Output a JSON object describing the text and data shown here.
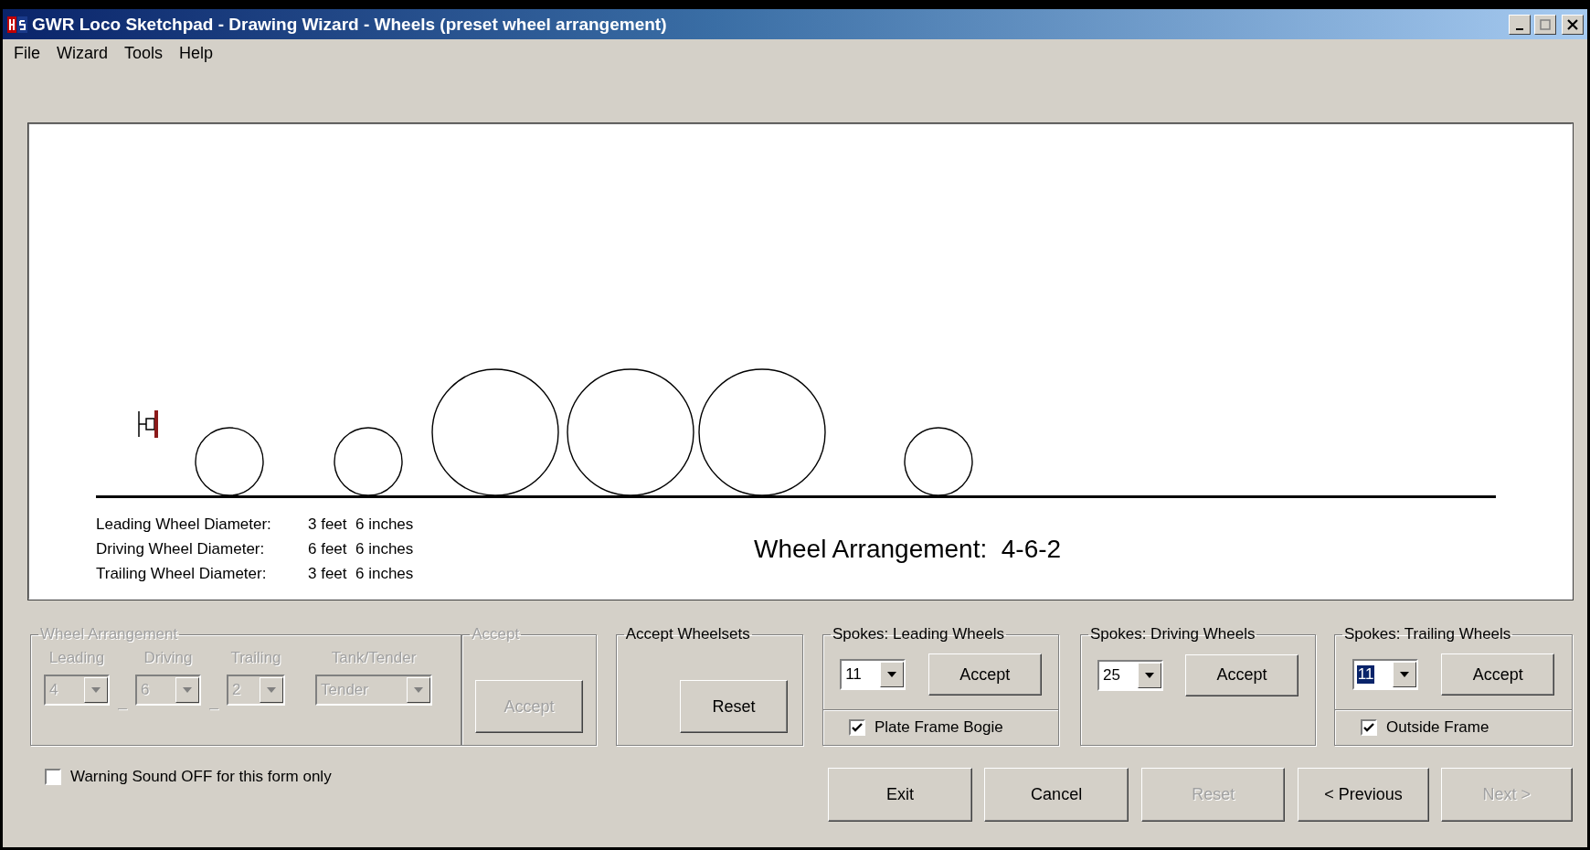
{
  "window": {
    "title": "GWR Loco Sketchpad - Drawing Wizard - Wheels (preset wheel arrangement)"
  },
  "menu": [
    {
      "label": "File"
    },
    {
      "label": "Wizard"
    },
    {
      "label": "Tools"
    },
    {
      "label": "Help"
    }
  ],
  "canvas": {
    "wheels": [
      {
        "kind": "leading"
      },
      {
        "kind": "leading"
      },
      {
        "kind": "driving"
      },
      {
        "kind": "driving"
      },
      {
        "kind": "driving"
      },
      {
        "kind": "trailing"
      }
    ],
    "diameters": [
      {
        "label": "Leading Wheel Diameter:",
        "value": "3 feet  6 inches"
      },
      {
        "label": "Driving Wheel Diameter:",
        "value": "6 feet  6 inches"
      },
      {
        "label": "Trailing Wheel Diameter:",
        "value": "3 feet  6 inches"
      }
    ],
    "arrangement": {
      "label": "Wheel Arrangement:",
      "value": "4-6-2"
    }
  },
  "wheel_arrangement": {
    "title": "Wheel Arrangement",
    "disabled": true,
    "fields": [
      {
        "label": "Leading",
        "value": "4",
        "separator": "_"
      },
      {
        "label": "Driving",
        "value": "6",
        "separator": "_"
      },
      {
        "label": "Trailing",
        "value": "2"
      },
      {
        "label": "Tank/Tender",
        "value": "Tender"
      }
    ]
  },
  "accept_group": {
    "title": "Accept",
    "disabled": true,
    "button": {
      "label": "Accept",
      "disabled": true
    }
  },
  "accept_wheelsets": {
    "title": "Accept Wheelsets",
    "button": {
      "label": "Reset",
      "disabled": false
    }
  },
  "spokes": [
    {
      "title": "Spokes: Leading Wheels",
      "value": "11",
      "selected": false,
      "button": "Accept",
      "option": {
        "label": "Plate Frame Bogie",
        "checked": true
      }
    },
    {
      "title": "Spokes: Driving Wheels",
      "value": "25",
      "selected": false,
      "button": "Accept"
    },
    {
      "title": "Spokes: Trailing Wheels",
      "value": "11",
      "selected": true,
      "button": "Accept",
      "option": {
        "label": "Outside Frame",
        "checked": true
      }
    }
  ],
  "warning_sound": {
    "label": "Warning Sound OFF for this form only",
    "checked": false
  },
  "buttons": [
    {
      "label": "Exit",
      "disabled": false
    },
    {
      "label": "Cancel",
      "disabled": false
    },
    {
      "label": "Reset",
      "disabled": true
    },
    {
      "label": "< Previous",
      "disabled": false
    },
    {
      "label": "Next >",
      "disabled": true
    }
  ]
}
